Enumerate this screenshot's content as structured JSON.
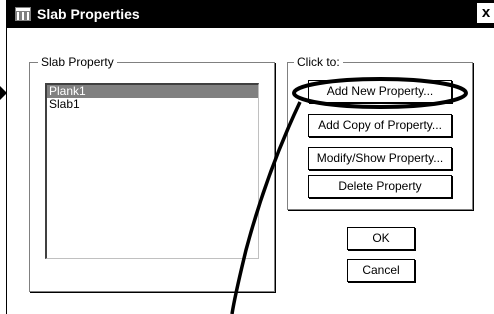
{
  "window": {
    "title": "Slab Properties",
    "close_glyph": "x"
  },
  "slab_property_group": {
    "label": "Slab Property",
    "items": [
      {
        "label": "Plank1",
        "selected": true
      },
      {
        "label": "Slab1",
        "selected": false
      }
    ]
  },
  "click_to_group": {
    "label": "Click to:",
    "buttons": {
      "add_new": "Add New Property...",
      "add_copy": "Add Copy of Property...",
      "modify_show": "Modify/Show Property...",
      "delete": "Delete Property"
    }
  },
  "dialog_buttons": {
    "ok": "OK",
    "cancel": "Cancel"
  },
  "annotation": {
    "highlighted_control": "Add New Property...",
    "color": "#000000"
  }
}
